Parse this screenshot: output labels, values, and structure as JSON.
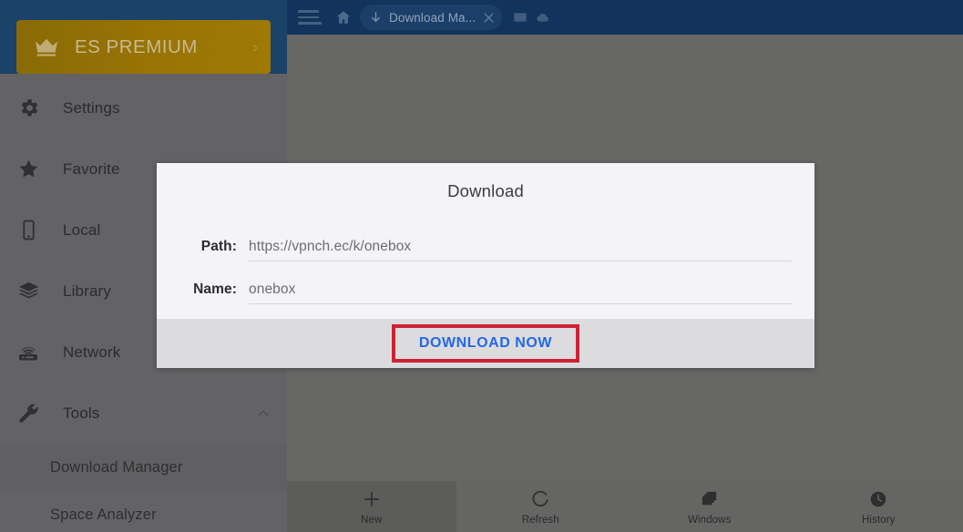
{
  "topbar": {
    "menu_icon": "hamburger-icon",
    "home_icon": "home-icon",
    "tab": {
      "icon": "download-arrow-icon",
      "label": "Download Ma...",
      "close_icon": "close-icon"
    },
    "right_icons": [
      {
        "name": "window-icon"
      },
      {
        "name": "cloud-icon"
      }
    ]
  },
  "sidebar": {
    "premium": {
      "icon": "crown-icon",
      "label": "ES PREMIUM",
      "chevron": "›"
    },
    "items": [
      {
        "label": "Settings",
        "icon": "gear-icon",
        "arrow": ""
      },
      {
        "label": "Favorite",
        "icon": "star-icon",
        "arrow": ""
      },
      {
        "label": "Local",
        "icon": "phone-icon",
        "arrow": ""
      },
      {
        "label": "Library",
        "icon": "layers-icon",
        "arrow": ""
      },
      {
        "label": "Network",
        "icon": "router-icon",
        "arrow": "chevron-down-icon"
      },
      {
        "label": "Tools",
        "icon": "wrench-icon",
        "arrow": "chevron-up-icon"
      }
    ],
    "sub_items": [
      {
        "label": "Download Manager"
      },
      {
        "label": "Space Analyzer"
      }
    ]
  },
  "dialog": {
    "title": "Download",
    "fields": [
      {
        "label": "Path:",
        "value": "https://vpnch.ec/k/onebox"
      },
      {
        "label": "Name:",
        "value": "onebox"
      }
    ],
    "primary_button": "DOWNLOAD NOW",
    "highlight_color": "#cc2235",
    "button_color": "#2567e8"
  },
  "bottom_nav": [
    {
      "label": "New",
      "icon": "plus-icon",
      "active": true
    },
    {
      "label": "Refresh",
      "icon": "refresh-icon",
      "active": false
    },
    {
      "label": "Windows",
      "icon": "windows-icon",
      "active": false
    },
    {
      "label": "History",
      "icon": "clock-icon",
      "active": false
    }
  ],
  "colors": {
    "header": "#12345c",
    "dim_overlay": "#676766",
    "premium_gold": "#9a7505",
    "accent_blue": "#2567e8",
    "highlight_red": "#cc2235"
  }
}
